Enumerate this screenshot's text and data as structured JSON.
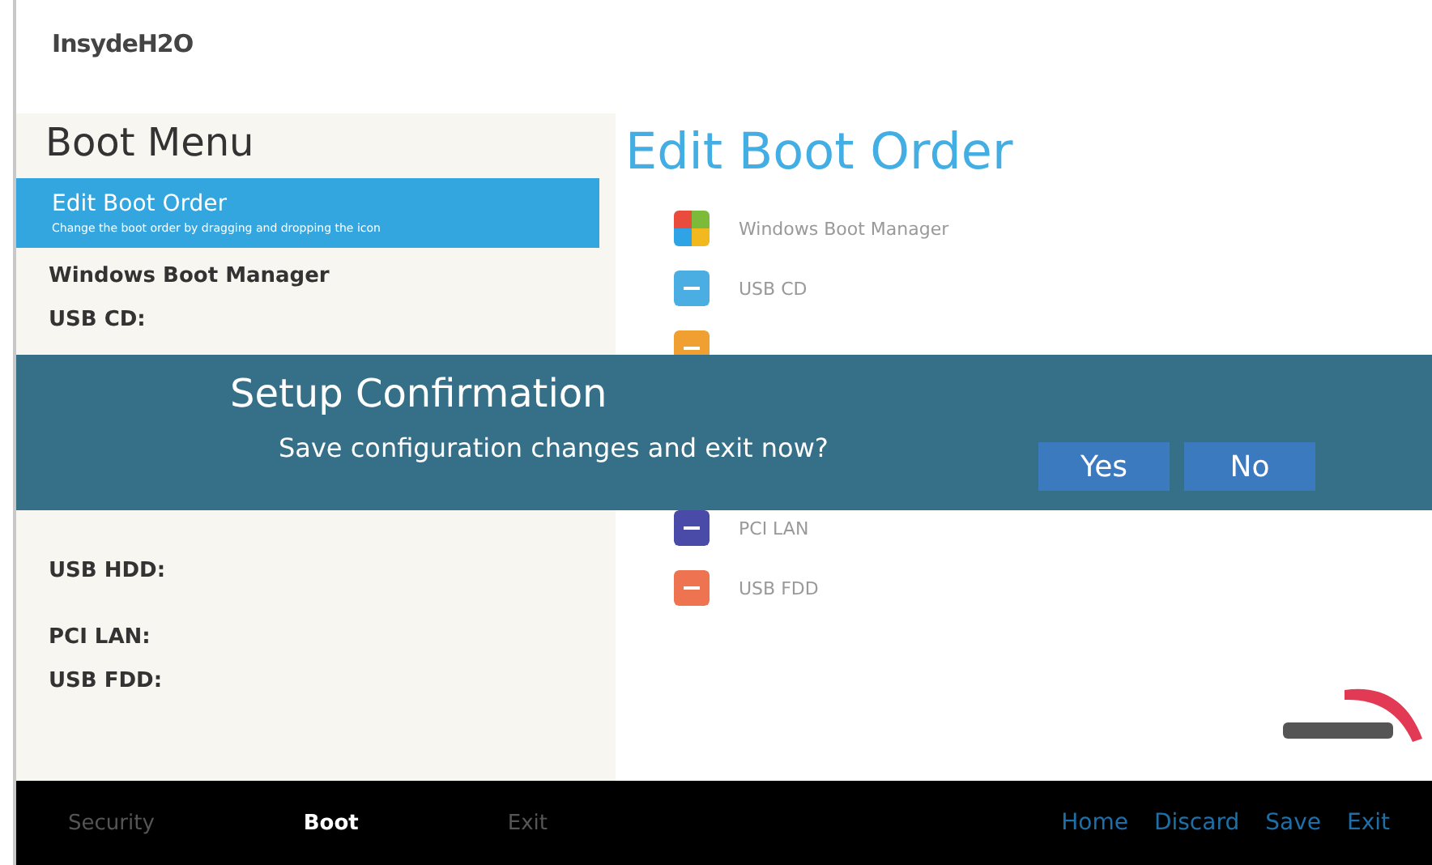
{
  "logo": "InsydeH2O",
  "boot_menu": {
    "title": "Boot Menu",
    "selected_item": {
      "label": "Edit Boot Order",
      "description": "Change the boot order by dragging and dropping the icon"
    },
    "groups": [
      [
        "Windows Boot Manager",
        "USB CD:"
      ],
      [
        "USB HDD:"
      ],
      [
        "PCI LAN:",
        "USB FDD:"
      ]
    ]
  },
  "edit_boot_order": {
    "title": "Edit Boot Order",
    "groups": [
      [
        {
          "label": "Windows Boot Manager",
          "kind": "windows",
          "color": "#e94b3c"
        },
        {
          "label": "USB CD",
          "kind": "device",
          "color": "#4aaee3"
        },
        {
          "kind": "device",
          "color": "#f0a030"
        }
      ],
      [
        {
          "label": "PCI LAN",
          "kind": "device",
          "color": "#4a4aa8"
        },
        {
          "label": "USB FDD",
          "kind": "device",
          "color": "#ee7350"
        }
      ]
    ]
  },
  "dialog": {
    "title": "Setup Confirmation",
    "message": "Save configuration changes and exit now?",
    "buttons": [
      "Yes",
      "No"
    ]
  },
  "footer": {
    "tabs": [
      {
        "label": "Security",
        "selected": false
      },
      {
        "label": "Boot",
        "selected": true
      },
      {
        "label": "Exit",
        "selected": false
      }
    ],
    "actions": [
      "Home",
      "Discard",
      "Save",
      "Exit"
    ]
  }
}
